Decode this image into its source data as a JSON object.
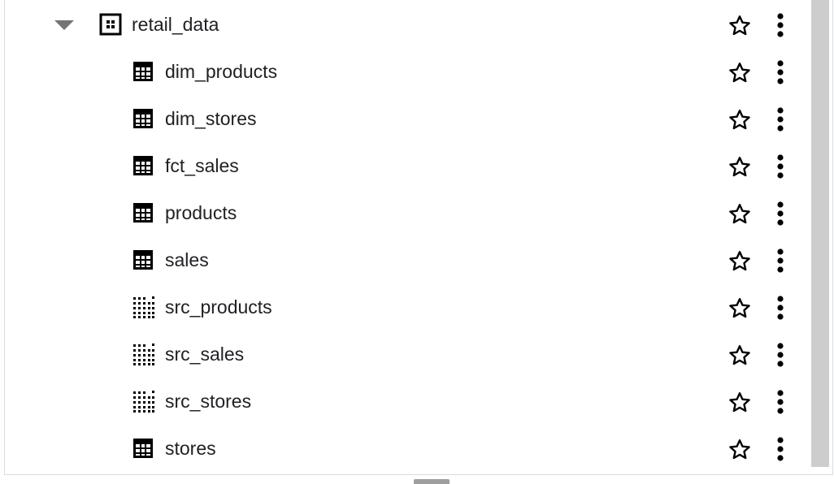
{
  "dataset": {
    "name": "retail_data",
    "icon": "dataset-icon",
    "expanded": true
  },
  "tables": [
    {
      "name": "dim_products",
      "icon": "table-icon"
    },
    {
      "name": "dim_stores",
      "icon": "table-icon"
    },
    {
      "name": "fct_sales",
      "icon": "table-icon"
    },
    {
      "name": "products",
      "icon": "table-icon"
    },
    {
      "name": "sales",
      "icon": "table-icon"
    },
    {
      "name": "src_products",
      "icon": "external-table-icon"
    },
    {
      "name": "src_sales",
      "icon": "external-table-icon"
    },
    {
      "name": "src_stores",
      "icon": "external-table-icon"
    },
    {
      "name": "stores",
      "icon": "table-icon"
    }
  ],
  "colors": {
    "text": "#202124",
    "icon": "#000000",
    "caret": "#757575",
    "scrollbar": "#cdcdcd"
  }
}
